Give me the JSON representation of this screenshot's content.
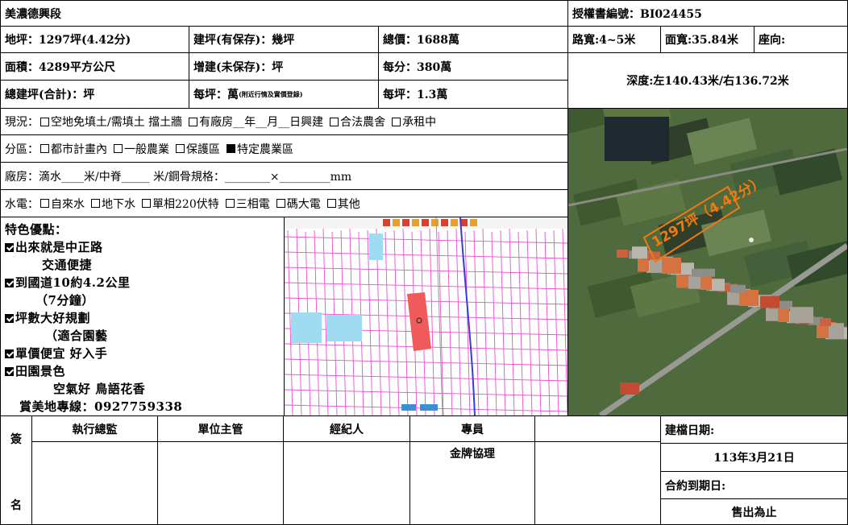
{
  "header": {
    "section_name": "美濃德興段",
    "auth_no": "授權書編號：BI024455"
  },
  "rows": {
    "land_area": "地坪：1297坪(4.42分)",
    "building_registered": "建坪(有保存)：幾坪",
    "total_price": "總價：1688萬",
    "road_width": "路寬:4~5米",
    "frontage": "面寬:35.84米",
    "orientation": "座向:",
    "area": "面積：4289平方公尺",
    "building_extension": "增建(未保存)：坪",
    "price_per_fen": "每分：380萬",
    "depth": "深度:左140.43米/右136.72米",
    "total_building": "總建坪(合計)：坪",
    "per_ping_label": "每坪：萬",
    "per_ping_note": "(附近行情及實價登錄)",
    "per_ping_price": "每坪：1.3萬"
  },
  "status": {
    "label": "現況：",
    "items": [
      {
        "text": "空地免填土/需填土 擋土牆",
        "checked": false
      },
      {
        "text": "有廠房__年__月__日興建",
        "checked": false
      },
      {
        "text": "合法農舍",
        "checked": false
      },
      {
        "text": "承租中",
        "checked": false
      }
    ]
  },
  "zoning": {
    "label": "分區：",
    "items": [
      {
        "text": "都市計畫內",
        "checked": false
      },
      {
        "text": "一般農業",
        "checked": false
      },
      {
        "text": "保護區",
        "checked": false
      },
      {
        "text": "特定農業區",
        "checked": true
      }
    ]
  },
  "factory": {
    "text": "廠房：滴水____米/中脊_____ 米/鋼骨規格：________×_________mm"
  },
  "utilities": {
    "label": "水電：",
    "items": [
      {
        "text": "自來水",
        "checked": false
      },
      {
        "text": "地下水",
        "checked": false
      },
      {
        "text": "單相220伏特",
        "checked": false
      },
      {
        "text": "三相電",
        "checked": false
      },
      {
        "text": "碼大電",
        "checked": false
      },
      {
        "text": "其他",
        "checked": false
      }
    ]
  },
  "features": {
    "title": "特色優點：",
    "lines": [
      {
        "text": "出來就是中正路",
        "checked": true
      },
      {
        "text": "交通便捷",
        "checked": null
      },
      {
        "text": "到國道10約4.2公里",
        "checked": true
      },
      {
        "text": "（7分鐘）",
        "checked": null
      },
      {
        "text": "坪數大好規劃",
        "checked": true
      },
      {
        "text": "（適合園藝",
        "checked": null
      },
      {
        "text": "單價便宜 好入手",
        "checked": true
      },
      {
        "text": "田園景色",
        "checked": true
      },
      {
        "text": "空氣好 鳥語花香",
        "checked": null
      },
      {
        "text": "賞美地專線：0927759338",
        "checked": null
      }
    ]
  },
  "aerial": {
    "label": "1297坪（4.42分）"
  },
  "signoff": {
    "sign_top": "簽",
    "sign_bottom": "名",
    "headers": [
      "執行總監",
      "單位主管",
      "經紀人",
      "專員",
      ""
    ],
    "specialist_value": "金牌協理",
    "date_label": "建檔日期:",
    "date_value": "113年3月21日",
    "expiry_label": "合約到期日:",
    "expiry_value": "售出為止"
  },
  "colors": {
    "cadastral_line": "#e84fd0",
    "parcel_fill": "#f05a5a",
    "water_fill": "#9fdcf2",
    "road_line": "#3a3ad8",
    "aerial_outline": "#f07a12"
  }
}
